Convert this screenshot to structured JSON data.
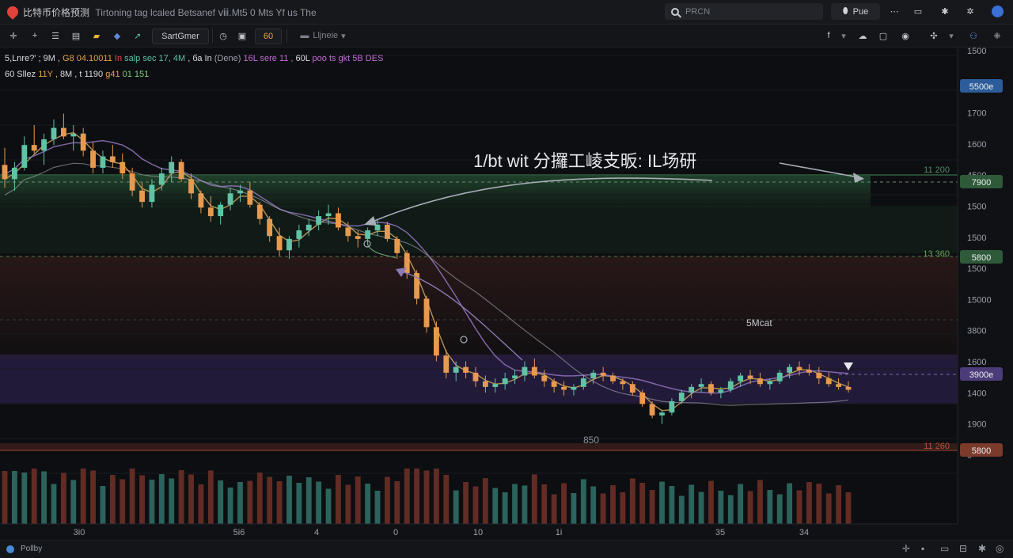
{
  "app": {
    "title": "比特币价格预测",
    "subtitle": "Tirtoning tag lcaled Betsanef ⅷ.Mt5 0 Mts Yf us The"
  },
  "search": {
    "placeholder": "PRCN"
  },
  "top_buttons": {
    "pill_label": "Pue"
  },
  "toolbar": {
    "symbol_label": "SartGmer",
    "interval_label": "60",
    "layout_label": "Lljneie"
  },
  "legend": {
    "line1": [
      {
        "text": "5,Lnre?' ; 9M , ",
        "color": "#d9dce2"
      },
      {
        "text": "G8 04.10011 ",
        "color": "#e1a44a"
      },
      {
        "text": "In ",
        "color": "#e04b44"
      },
      {
        "text": "salp sec 17, 4M ",
        "color": "#5fbfa6"
      },
      {
        "text": ", ба In ",
        "color": "#d9dce2"
      },
      {
        "text": "(Dene)  ",
        "color": "#9aa0aa"
      },
      {
        "text": "16L sere 11 , ",
        "color": "#c36bd6"
      },
      {
        "text": "60L ",
        "color": "#d9dce2"
      },
      {
        "text": "poo ts gkt 5B DES",
        "color": "#c36bd6"
      }
    ],
    "line2": [
      {
        "text": "60 Sllez  ",
        "color": "#d9dce2"
      },
      {
        "text": "11Y , ",
        "color": "#e1a44a"
      },
      {
        "text": "8M , t 1190 ",
        "color": "#d9dce2"
      },
      {
        "text": "g41 ",
        "color": "#e1a44a"
      },
      {
        "text": "01 151",
        "color": "#7fcf7f"
      }
    ]
  },
  "annotations": {
    "headline": "1/bt wit 分攞工崚支昄: IL场研",
    "label_peak": "5Mcat",
    "label_low": "850"
  },
  "price_axis": {
    "ticks": [
      "1500",
      "4500",
      "1700",
      "1600",
      "4500",
      "1500",
      "1500",
      "1500",
      "15000",
      "3800",
      "1600",
      "1400",
      "1900",
      "0"
    ],
    "badges": [
      {
        "text": "5500e",
        "color": "#2c5d9a"
      },
      {
        "text": "7900",
        "color": "#2f5a3a"
      },
      {
        "text": "5800",
        "color": "#2f5a3a"
      },
      {
        "text": "3900e",
        "color": "#4b3b78"
      },
      {
        "text": "5800",
        "color": "#7a3a2c"
      }
    ],
    "level_labels": [
      "11 200",
      "13 360",
      "11 260"
    ]
  },
  "time_axis": {
    "ticks": [
      "3i0",
      "5i6",
      "4",
      "0",
      "10",
      "1i",
      "35",
      "34"
    ]
  },
  "status": {
    "left_label": "Pollby"
  },
  "colors": {
    "up": "#5fc4a6",
    "down": "#e79a4f",
    "ma_fast": "#c8a15a",
    "ma_slow": "#8a6fb5",
    "ma_long": "#a7a7b0",
    "support_zone": "#5b3fa0",
    "resist_zone": "#2d6a3e"
  },
  "chart_data": {
    "type": "candlestick",
    "candles": [
      [
        1650,
        1710,
        1570,
        1600
      ],
      [
        1600,
        1660,
        1560,
        1640
      ],
      [
        1640,
        1750,
        1630,
        1720
      ],
      [
        1720,
        1790,
        1690,
        1700
      ],
      [
        1700,
        1760,
        1650,
        1740
      ],
      [
        1740,
        1810,
        1720,
        1780
      ],
      [
        1780,
        1830,
        1740,
        1750
      ],
      [
        1750,
        1790,
        1700,
        1760
      ],
      [
        1760,
        1780,
        1680,
        1700
      ],
      [
        1700,
        1730,
        1620,
        1640
      ],
      [
        1640,
        1700,
        1620,
        1680
      ],
      [
        1680,
        1720,
        1640,
        1660
      ],
      [
        1660,
        1690,
        1600,
        1620
      ],
      [
        1620,
        1640,
        1540,
        1560
      ],
      [
        1560,
        1590,
        1500,
        1520
      ],
      [
        1520,
        1600,
        1500,
        1580
      ],
      [
        1580,
        1640,
        1560,
        1620
      ],
      [
        1620,
        1680,
        1590,
        1660
      ],
      [
        1660,
        1670,
        1590,
        1600
      ],
      [
        1600,
        1620,
        1530,
        1550
      ],
      [
        1550,
        1560,
        1480,
        1500
      ],
      [
        1500,
        1540,
        1450,
        1470
      ],
      [
        1470,
        1520,
        1440,
        1510
      ],
      [
        1510,
        1570,
        1490,
        1550
      ],
      [
        1550,
        1580,
        1520,
        1560
      ],
      [
        1560,
        1590,
        1500,
        1510
      ],
      [
        1510,
        1520,
        1440,
        1460
      ],
      [
        1460,
        1470,
        1380,
        1400
      ],
      [
        1400,
        1430,
        1330,
        1350
      ],
      [
        1350,
        1400,
        1320,
        1390
      ],
      [
        1390,
        1440,
        1360,
        1420
      ],
      [
        1420,
        1460,
        1400,
        1440
      ],
      [
        1440,
        1490,
        1420,
        1470
      ],
      [
        1470,
        1510,
        1440,
        1480
      ],
      [
        1480,
        1500,
        1420,
        1430
      ],
      [
        1430,
        1450,
        1380,
        1400
      ],
      [
        1400,
        1420,
        1360,
        1390
      ],
      [
        1390,
        1430,
        1370,
        1420
      ],
      [
        1420,
        1460,
        1400,
        1440
      ],
      [
        1440,
        1450,
        1380,
        1390
      ],
      [
        1390,
        1400,
        1320,
        1340
      ],
      [
        1340,
        1350,
        1250,
        1270
      ],
      [
        1270,
        1280,
        1160,
        1180
      ],
      [
        1180,
        1190,
        1060,
        1080
      ],
      [
        1080,
        1100,
        960,
        980
      ],
      [
        980,
        1000,
        900,
        920
      ],
      [
        920,
        960,
        890,
        940
      ],
      [
        940,
        960,
        900,
        920
      ],
      [
        920,
        940,
        870,
        890
      ],
      [
        890,
        910,
        850,
        870
      ],
      [
        870,
        900,
        850,
        880
      ],
      [
        880,
        920,
        860,
        900
      ],
      [
        900,
        930,
        880,
        910
      ],
      [
        910,
        960,
        890,
        940
      ],
      [
        940,
        970,
        900,
        910
      ],
      [
        910,
        930,
        870,
        890
      ],
      [
        890,
        900,
        850,
        870
      ],
      [
        870,
        890,
        840,
        860
      ],
      [
        860,
        880,
        840,
        870
      ],
      [
        870,
        910,
        860,
        900
      ],
      [
        900,
        930,
        880,
        920
      ],
      [
        920,
        940,
        890,
        910
      ],
      [
        910,
        920,
        880,
        890
      ],
      [
        890,
        900,
        860,
        880
      ],
      [
        880,
        890,
        840,
        850
      ],
      [
        850,
        860,
        800,
        810
      ],
      [
        810,
        820,
        760,
        770
      ],
      [
        770,
        790,
        740,
        780
      ],
      [
        780,
        830,
        770,
        820
      ],
      [
        820,
        860,
        810,
        850
      ],
      [
        850,
        880,
        830,
        870
      ],
      [
        870,
        900,
        850,
        880
      ],
      [
        880,
        890,
        840,
        850
      ],
      [
        850,
        870,
        830,
        860
      ],
      [
        860,
        900,
        850,
        890
      ],
      [
        890,
        920,
        870,
        910
      ],
      [
        910,
        930,
        880,
        900
      ],
      [
        900,
        920,
        870,
        880
      ],
      [
        880,
        900,
        860,
        890
      ],
      [
        890,
        930,
        880,
        920
      ],
      [
        920,
        950,
        900,
        940
      ],
      [
        940,
        960,
        910,
        930
      ],
      [
        930,
        950,
        910,
        920
      ],
      [
        920,
        940,
        880,
        900
      ],
      [
        900,
        920,
        870,
        880
      ],
      [
        880,
        900,
        860,
        870
      ],
      [
        870,
        890,
        850,
        860
      ]
    ]
  }
}
